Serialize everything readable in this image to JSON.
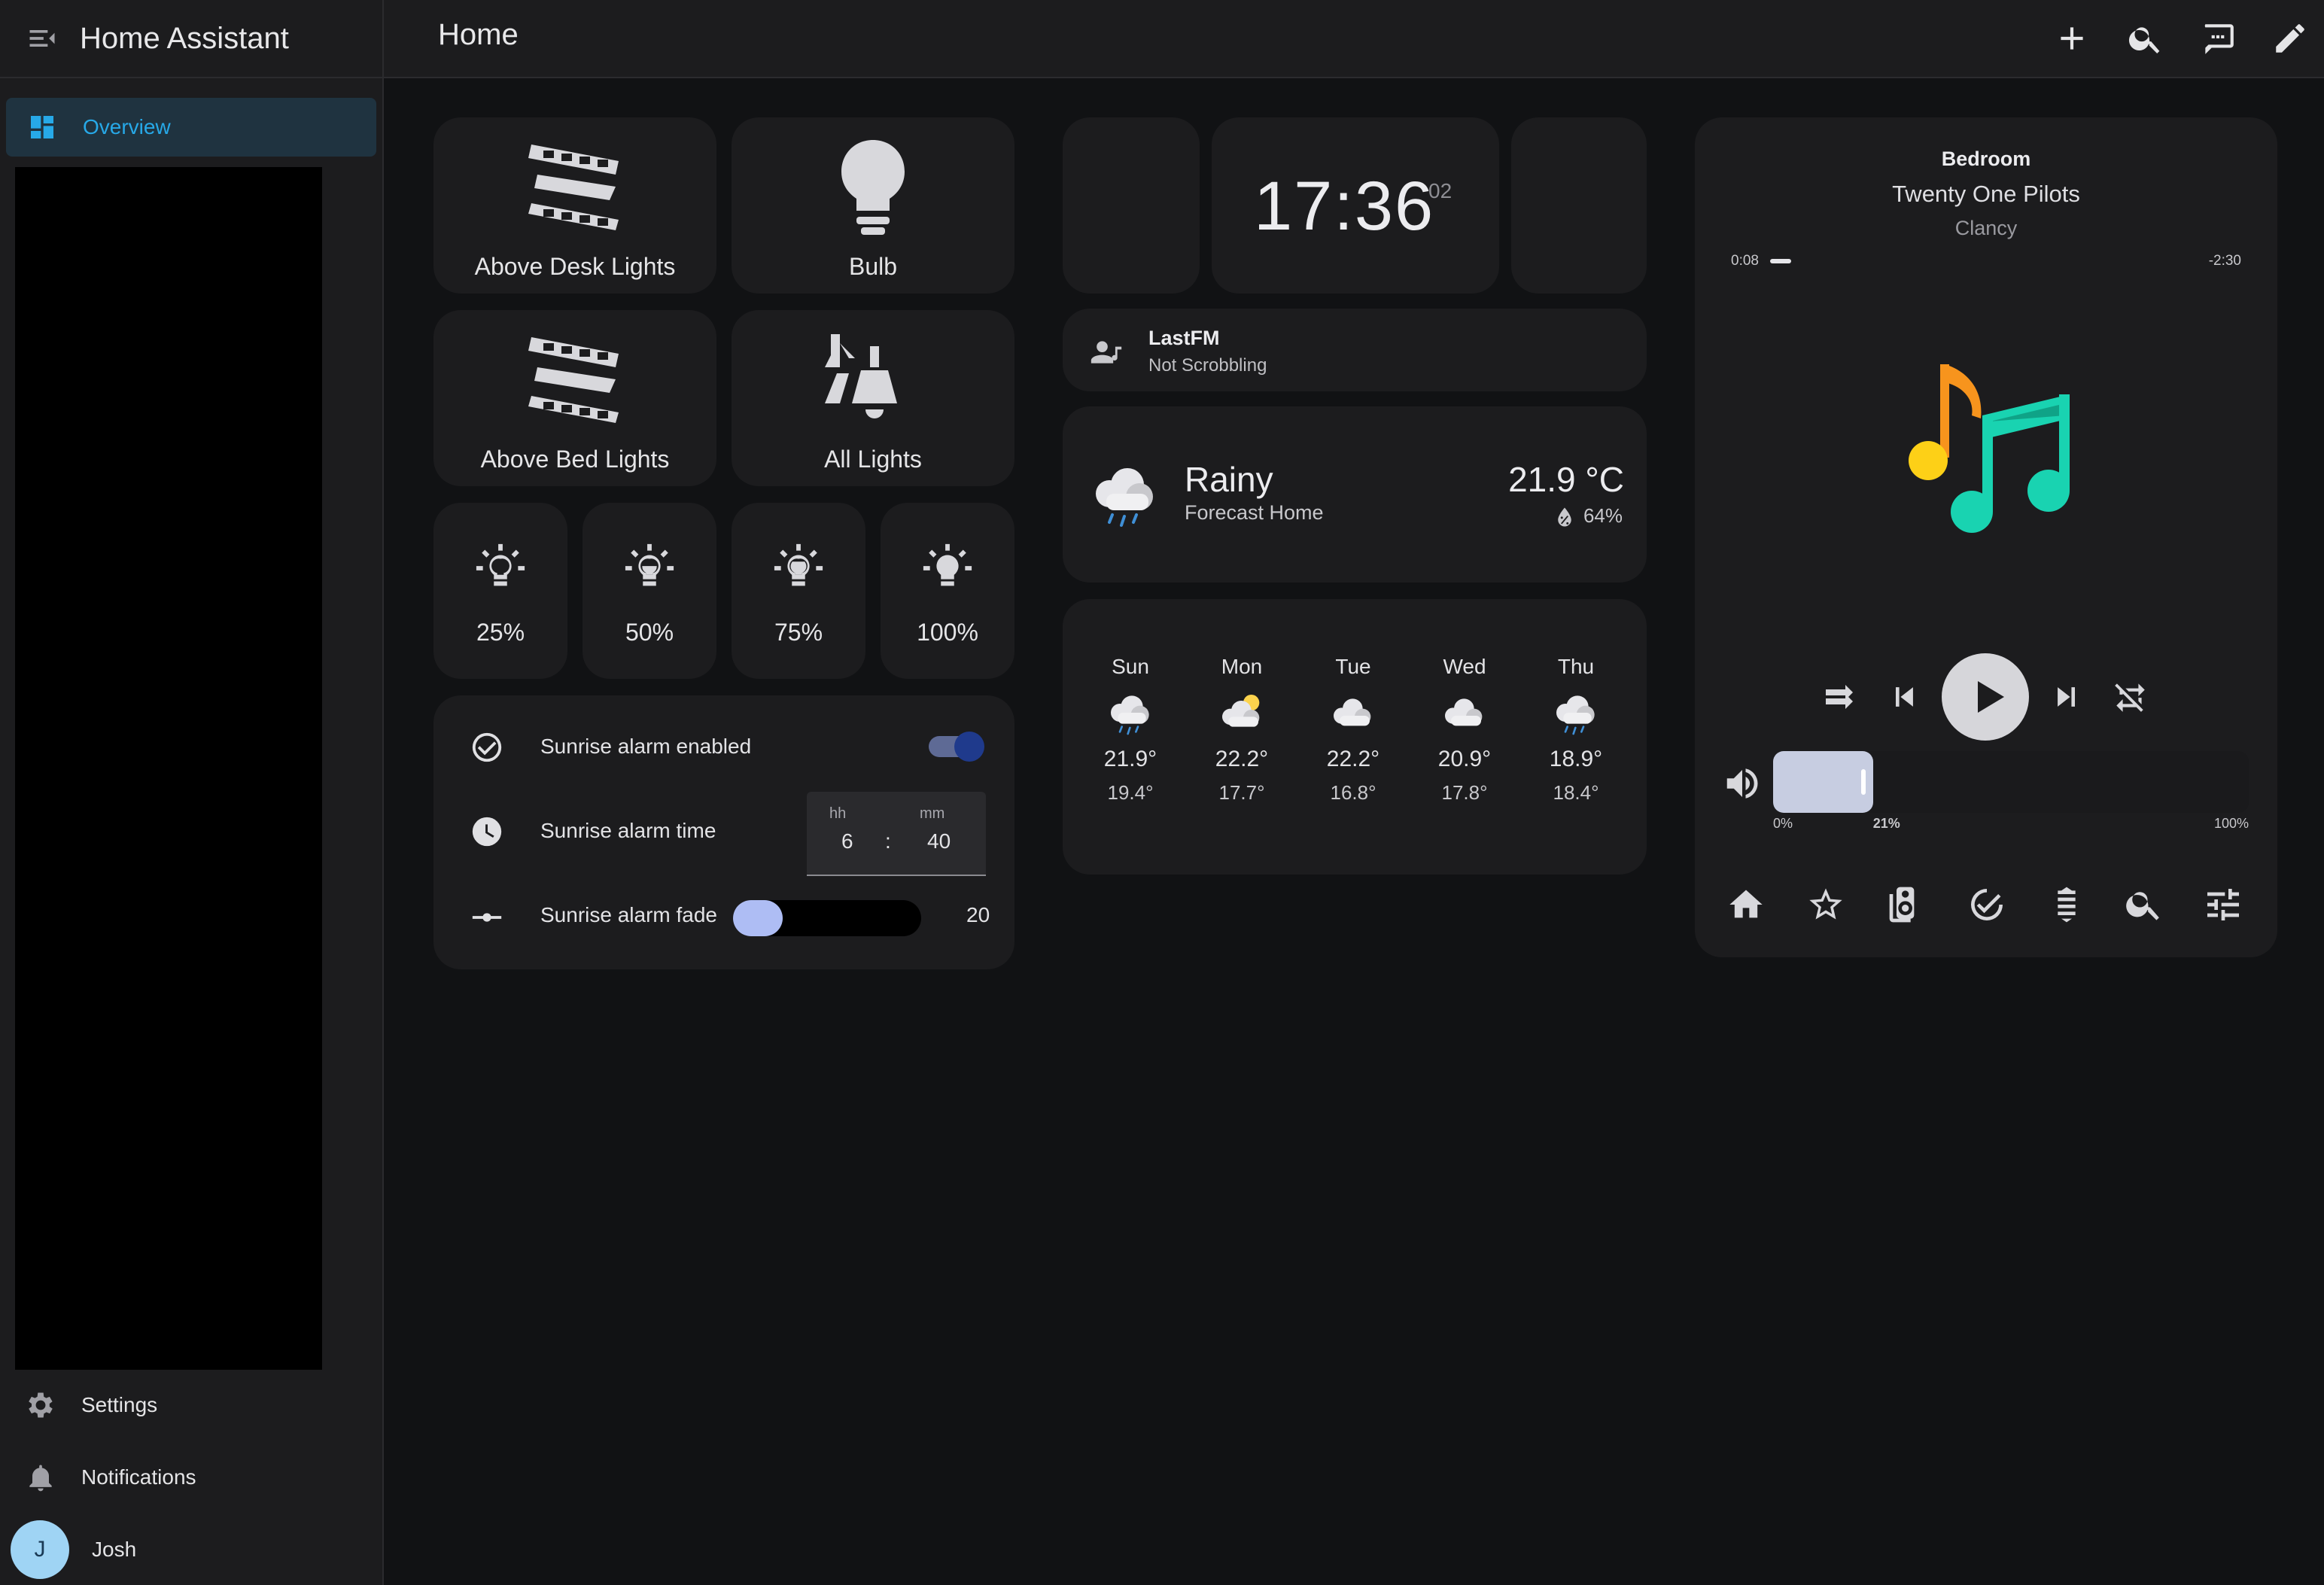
{
  "app": {
    "title": "Home Assistant",
    "page_title": "Home"
  },
  "sidebar": {
    "nav": [
      {
        "label": "Overview",
        "icon": "dashboard-icon"
      }
    ],
    "settings_label": "Settings",
    "notifications_label": "Notifications",
    "user": {
      "initial": "J",
      "name": "Josh"
    }
  },
  "topbar_icons": [
    "plus-icon",
    "search-icon",
    "assist-icon",
    "pencil-icon"
  ],
  "lights": {
    "above_desk": "Above Desk Lights",
    "bulb": "Bulb",
    "above_bed": "Above Bed Lights",
    "all": "All Lights",
    "brightness_presets": [
      "25%",
      "50%",
      "75%",
      "100%"
    ]
  },
  "sunrise": {
    "enabled_label": "Sunrise alarm enabled",
    "enabled": true,
    "time_label": "Sunrise alarm time",
    "hh_label": "hh",
    "mm_label": "mm",
    "hours": "6",
    "separator": ":",
    "minutes": "40",
    "fade_label": "Sunrise alarm fade",
    "fade_value": "20",
    "fade_fraction": 0.12
  },
  "clock": {
    "time": "17:36",
    "seconds": "02"
  },
  "lastfm": {
    "title": "LastFM",
    "status": "Not Scrobbling"
  },
  "weather": {
    "condition": "Rainy",
    "location": "Forecast Home",
    "temperature": "21.9 °C",
    "humidity": "64%",
    "forecast": [
      {
        "day": "Sun",
        "high": "21.9°",
        "low": "19.4°",
        "icon": "rainy-icon"
      },
      {
        "day": "Mon",
        "high": "22.2°",
        "low": "17.7°",
        "icon": "partly-cloudy-icon"
      },
      {
        "day": "Tue",
        "high": "22.2°",
        "low": "16.8°",
        "icon": "cloudy-icon"
      },
      {
        "day": "Wed",
        "high": "20.9°",
        "low": "17.8°",
        "icon": "cloudy-icon"
      },
      {
        "day": "Thu",
        "high": "18.9°",
        "low": "18.4°",
        "icon": "rainy-icon"
      }
    ]
  },
  "media": {
    "player": "Bedroom",
    "title": "Twenty One Pilots",
    "subtitle": "Clancy",
    "elapsed": "0:08",
    "remaining": "-2:30",
    "progress_fraction": 0.05,
    "volume_min": "0%",
    "volume_value": "21%",
    "volume_max": "100%",
    "volume_fraction": 0.21
  },
  "colors": {
    "accent": "#27a9e8",
    "note_orange": "#f7941d",
    "note_yellow": "#fdd017",
    "note_teal": "#19d3b1",
    "toggle_track": "#8b9bd0",
    "toggle_thumb": "#1a3a8a",
    "slider_fill": "#aebdf4",
    "volume_fill": "#c7cde1"
  }
}
